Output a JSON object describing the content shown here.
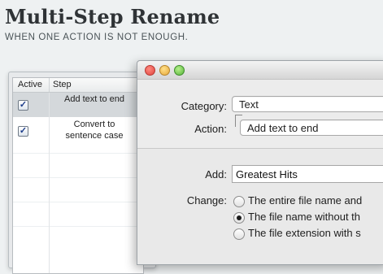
{
  "hero": {
    "title": "Multi-Step Rename",
    "subtitle": "WHEN ONE ACTION IS NOT ENOUGH."
  },
  "steps_table": {
    "columns": [
      "Active",
      "Step"
    ],
    "rows": [
      {
        "active": true,
        "step": "Add text to end",
        "selected": true
      },
      {
        "active": true,
        "step_line1": "Convert to",
        "step_line2": "sentence case",
        "selected": false
      }
    ]
  },
  "dialog": {
    "category_label": "Category:",
    "category_value": "Text",
    "action_label": "Action:",
    "action_value": "Add text to end",
    "add_label": "Add:",
    "add_value": "Greatest Hits",
    "change_label": "Change:",
    "change_options": [
      {
        "label": "The entire file name and",
        "selected": false
      },
      {
        "label": "The file name without th",
        "selected": true
      },
      {
        "label": "The file extension with s",
        "selected": false
      }
    ]
  },
  "colors": {
    "page_background": "#eef1f2",
    "selected_row": "#d4d8db",
    "close_button": "#e0443e",
    "minimize_button": "#e6a83a",
    "zoom_button": "#57b43a"
  },
  "icons": [
    "checkbox-checked-icon",
    "radio-selected-icon",
    "radio-unselected-icon"
  ]
}
